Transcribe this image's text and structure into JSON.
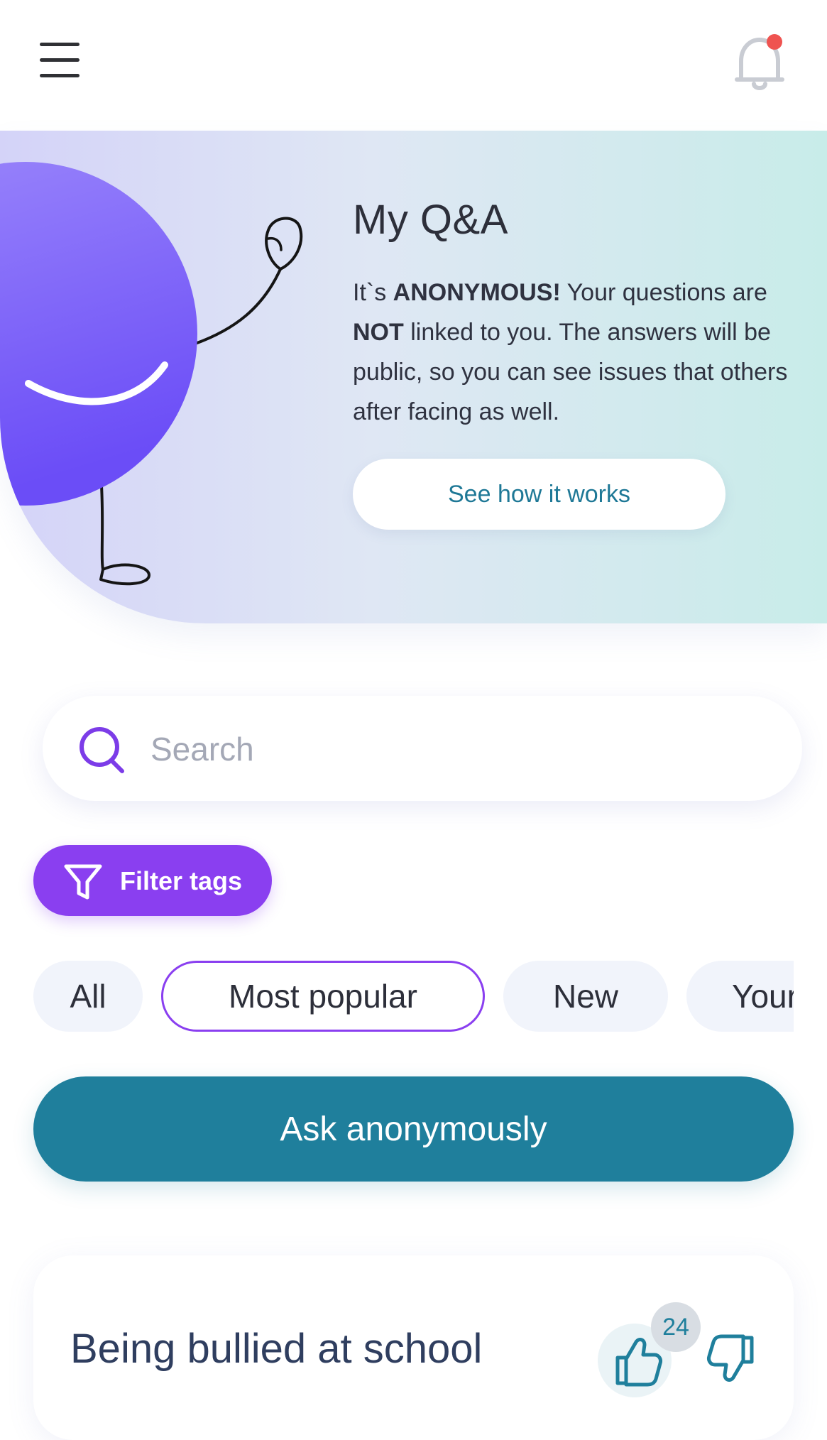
{
  "header": {
    "menu_icon": "hamburger-menu-icon",
    "notification_icon": "bell-icon",
    "notification_dot_color": "#ef5350"
  },
  "hero": {
    "title": "My Q&A",
    "description": {
      "part1": "It`s ",
      "bold1": "ANONYMOUS!",
      "part2": " Your questions are ",
      "bold2": "NOT",
      "part3": " linked to you. The answers will be public, so you can see issues that others after facing as well."
    },
    "cta_label": "See how it works"
  },
  "search": {
    "placeholder": "Search",
    "value": ""
  },
  "filter": {
    "label": "Filter tags",
    "color": "#8a3ff0"
  },
  "tabs": [
    {
      "label": "All",
      "active": false
    },
    {
      "label": "Most popular",
      "active": true
    },
    {
      "label": "New",
      "active": false
    },
    {
      "label": "Your",
      "active": false
    }
  ],
  "ask": {
    "label": "Ask anonymously",
    "color": "#1f7f9c"
  },
  "question_card": {
    "title": "Being bullied at school",
    "like_count": "24"
  }
}
